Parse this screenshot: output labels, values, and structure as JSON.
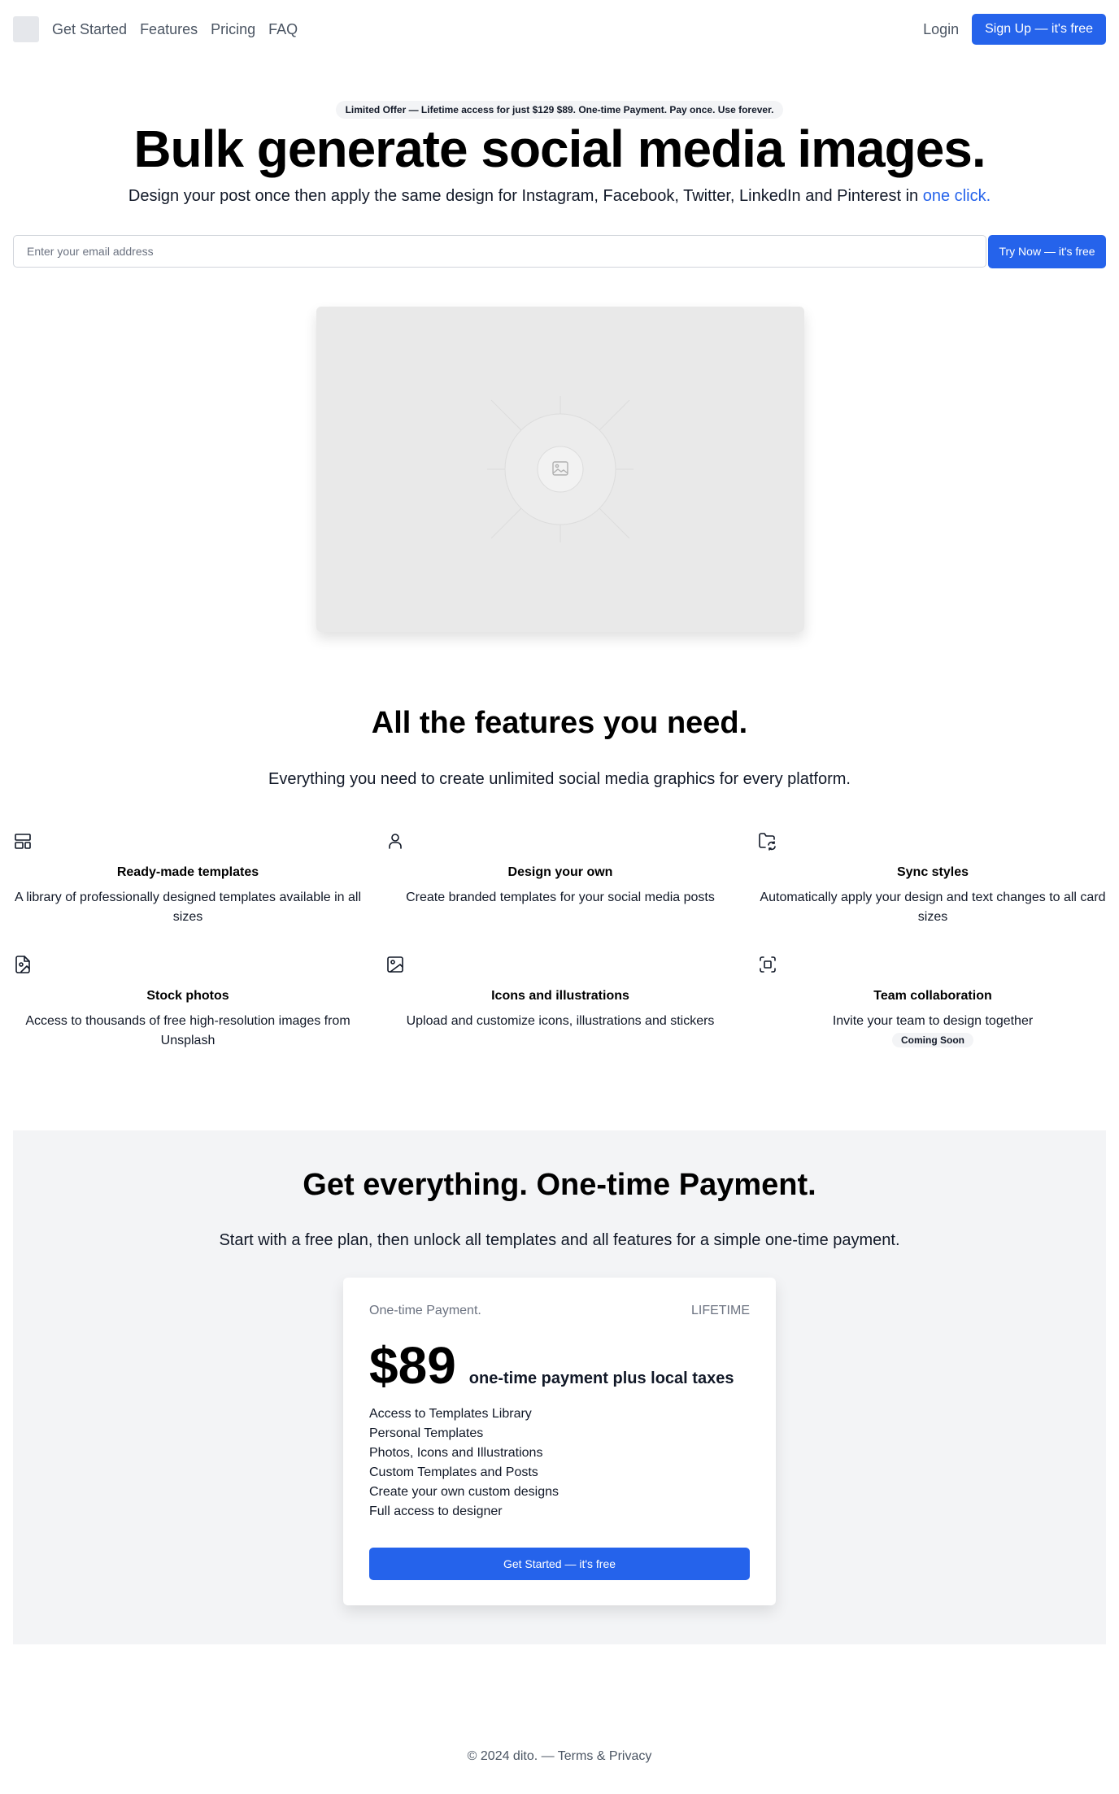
{
  "nav": {
    "links": [
      "Get Started",
      "Features",
      "Pricing",
      "FAQ"
    ],
    "login": "Login",
    "signup": "Sign Up — it's free"
  },
  "hero": {
    "offer": "Limited Offer — Lifetime access for just $129 $89. One-time Payment. Pay once. Use forever.",
    "title": "Bulk generate social media images.",
    "subtitle": "Design your post once then apply the same design for Instagram, Facebook, Twitter, LinkedIn and Pinterest in",
    "subtitle_accent": "one click.",
    "email_placeholder": "Enter your email address",
    "try_button": "Try Now — it's free",
    "image_icon": "image-icon"
  },
  "features": {
    "title": "All the features you need.",
    "subtitle": "Everything you need to create unlimited social media graphics for every platform.",
    "items": [
      {
        "icon": "layout-template-icon",
        "title": "Ready-made templates",
        "text": "A library of professionally designed templates available in all sizes"
      },
      {
        "icon": "user-icon",
        "title": "Design your own",
        "text": "Create branded templates for your social media posts"
      },
      {
        "icon": "folder-sync-icon",
        "title": "Sync styles",
        "text": "Automatically apply your design and text changes to all card sizes"
      },
      {
        "icon": "file-image-icon",
        "title": "Stock photos",
        "text": "Access to thousands of free high-resolution images from Unsplash"
      },
      {
        "icon": "image-icon",
        "title": "Icons and illustrations",
        "text": "Upload and customize icons, illustrations and stickers"
      },
      {
        "icon": "scan-icon",
        "title": "Team collaboration",
        "text": "Invite your team to design together",
        "badge": "Coming Soon"
      }
    ]
  },
  "pricing": {
    "title": "Get everything. One-time Payment.",
    "subtitle": "Start with a free plan, then unlock all templates and all features for a simple one-time payment.",
    "card_label": "One-time Payment.",
    "card_tag": "LIFETIME",
    "price": "$89",
    "price_note": "one-time payment plus local taxes",
    "features": [
      "Access to Templates Library",
      "Personal Templates",
      "Photos, Icons and Illustrations",
      "Custom Templates and Posts",
      "Create your own custom designs",
      "Full access to designer"
    ],
    "cta": "Get Started — it's free"
  },
  "footer": {
    "text": "© 2024 dito. — Terms & Privacy"
  },
  "colors": {
    "accent": "#2563eb",
    "section_bg": "#f3f4f6",
    "placeholder_bg": "#e9e9e9"
  }
}
